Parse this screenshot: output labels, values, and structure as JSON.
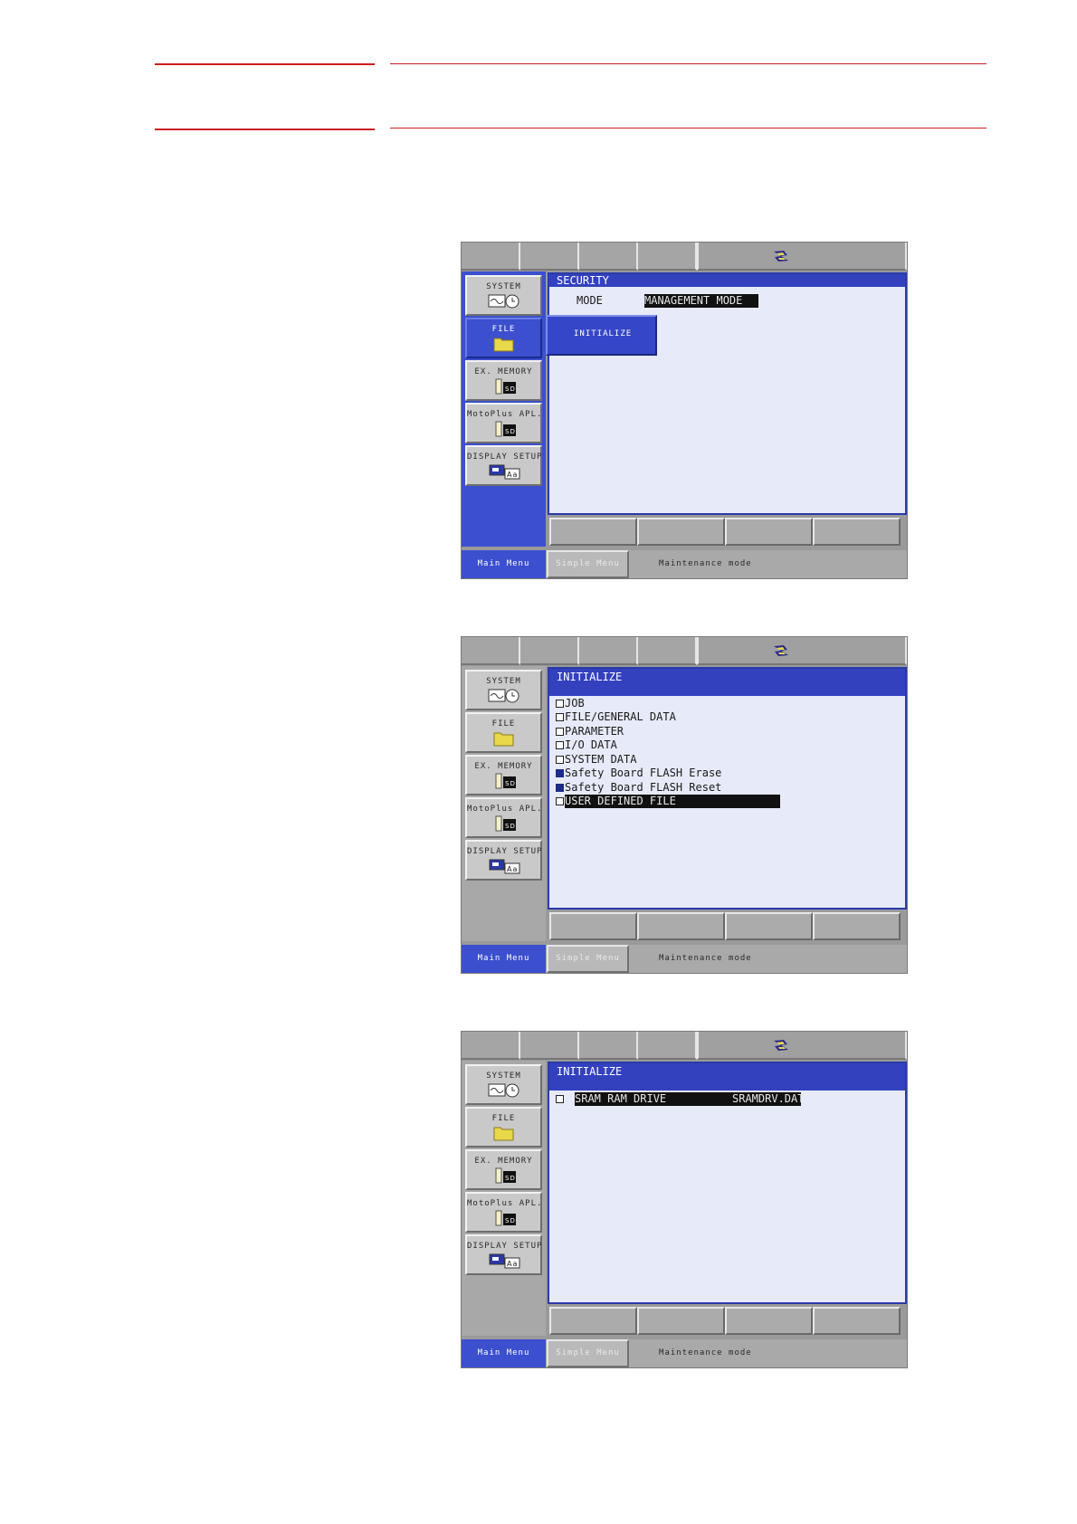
{
  "screens": [
    {
      "sidebar": [
        {
          "label": "SYSTEM",
          "icon": "system-icon"
        },
        {
          "label": "FILE",
          "icon": "folder-icon"
        },
        {
          "label": "EX. MEMORY",
          "icon": "sd-card-icon"
        },
        {
          "label": "MotoPlus APL.",
          "icon": "sd-card-icon"
        },
        {
          "label": "DISPLAY SETUP",
          "icon": "display-setup-icon"
        }
      ],
      "title": "SECURITY",
      "mode_label": "MODE",
      "mode_value": "MANAGEMENT MODE",
      "popup_item": "INITIALIZE",
      "main_menu": "Main Menu",
      "simple_menu": "Simple Menu",
      "status": "Maintenance mode"
    },
    {
      "sidebar": [
        {
          "label": "SYSTEM",
          "icon": "system-icon"
        },
        {
          "label": "FILE",
          "icon": "folder-icon"
        },
        {
          "label": "EX. MEMORY",
          "icon": "sd-card-icon"
        },
        {
          "label": "MotoPlus APL.",
          "icon": "sd-card-icon"
        },
        {
          "label": "DISPLAY SETUP",
          "icon": "display-setup-icon"
        }
      ],
      "title": "INITIALIZE",
      "items": [
        {
          "label": "JOB",
          "checked": false
        },
        {
          "label": "FILE/GENERAL DATA",
          "checked": false
        },
        {
          "label": "PARAMETER",
          "checked": false
        },
        {
          "label": "I/O DATA",
          "checked": false
        },
        {
          "label": "SYSTEM DATA",
          "checked": false
        },
        {
          "label": "Safety Board FLASH Erase",
          "checked": true
        },
        {
          "label": "Safety Board FLASH Reset",
          "checked": true
        },
        {
          "label": "USER DEFINED FILE",
          "checked": false,
          "selected": true
        }
      ],
      "main_menu": "Main Menu",
      "simple_menu": "Simple Menu",
      "status": "Maintenance mode"
    },
    {
      "sidebar": [
        {
          "label": "SYSTEM",
          "icon": "system-icon"
        },
        {
          "label": "FILE",
          "icon": "folder-icon"
        },
        {
          "label": "EX. MEMORY",
          "icon": "sd-card-icon"
        },
        {
          "label": "MotoPlus APL.",
          "icon": "sd-card-icon"
        },
        {
          "label": "DISPLAY SETUP",
          "icon": "display-setup-icon"
        }
      ],
      "title": "INITIALIZE",
      "file_row": {
        "name": "SRAM RAM DRIVE",
        "file": "SRAMDRV.DAT"
      },
      "main_menu": "Main Menu",
      "simple_menu": "Simple Menu",
      "status": "Maintenance mode"
    }
  ],
  "colors": {
    "accent_red": "#cc1f1f",
    "panel_blue": "#3c4fcf",
    "content_bg": "#e7eaf8"
  }
}
